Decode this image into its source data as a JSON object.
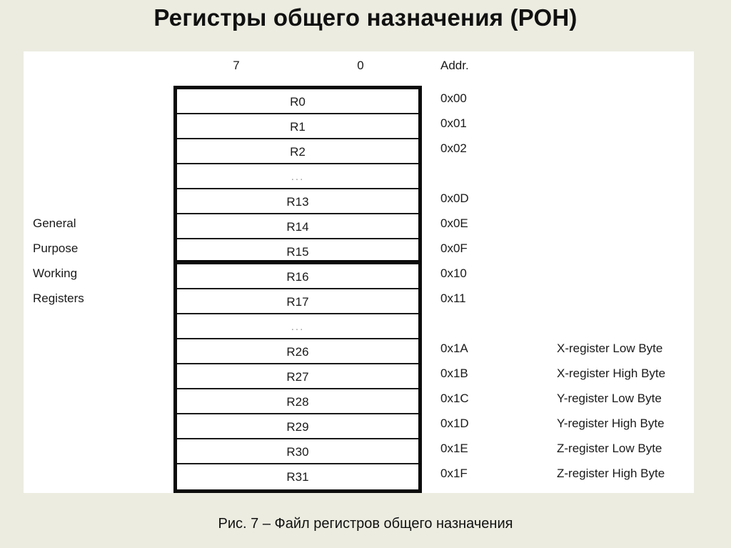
{
  "slide": {
    "title": "Регистры общего назначения (РОН)",
    "caption": "Рис. 7 – Файл регистров общего назначения"
  },
  "table_headers": {
    "msb": "7",
    "lsb": "0",
    "addr": "Addr."
  },
  "group_label": {
    "lines": [
      "General",
      "Purpose",
      "Working",
      "Registers"
    ]
  },
  "colors": {
    "slide_background": "#ECECE1",
    "panel_background": "#FFFFFF",
    "table_border": "#0B0B0B",
    "row_divider": "#1A1A1A",
    "text": "#1A1A1A",
    "ellipsis_text": "#9A9A9A"
  },
  "register_file": {
    "rows": [
      {
        "name": "R0",
        "addr": "0x00",
        "pointer": "",
        "bank_end": false,
        "ellipsis": false
      },
      {
        "name": "R1",
        "addr": "0x01",
        "pointer": "",
        "bank_end": false,
        "ellipsis": false
      },
      {
        "name": "R2",
        "addr": "0x02",
        "pointer": "",
        "bank_end": false,
        "ellipsis": false
      },
      {
        "name": "...",
        "addr": "",
        "pointer": "",
        "bank_end": false,
        "ellipsis": true
      },
      {
        "name": "R13",
        "addr": "0x0D",
        "pointer": "",
        "bank_end": false,
        "ellipsis": false
      },
      {
        "name": "R14",
        "addr": "0x0E",
        "pointer": "",
        "bank_end": false,
        "ellipsis": false
      },
      {
        "name": "R15",
        "addr": "0x0F",
        "pointer": "",
        "bank_end": true,
        "ellipsis": false
      },
      {
        "name": "R16",
        "addr": "0x10",
        "pointer": "",
        "bank_end": false,
        "ellipsis": false
      },
      {
        "name": "R17",
        "addr": "0x11",
        "pointer": "",
        "bank_end": false,
        "ellipsis": false
      },
      {
        "name": "...",
        "addr": "",
        "pointer": "",
        "bank_end": false,
        "ellipsis": true
      },
      {
        "name": "R26",
        "addr": "0x1A",
        "pointer": "X-register Low Byte",
        "bank_end": false,
        "ellipsis": false
      },
      {
        "name": "R27",
        "addr": "0x1B",
        "pointer": "X-register High Byte",
        "bank_end": false,
        "ellipsis": false
      },
      {
        "name": "R28",
        "addr": "0x1C",
        "pointer": "Y-register Low Byte",
        "bank_end": false,
        "ellipsis": false
      },
      {
        "name": "R29",
        "addr": "0x1D",
        "pointer": "Y-register High Byte",
        "bank_end": false,
        "ellipsis": false
      },
      {
        "name": "R30",
        "addr": "0x1E",
        "pointer": "Z-register Low Byte",
        "bank_end": false,
        "ellipsis": false
      },
      {
        "name": "R31",
        "addr": "0x1F",
        "pointer": "Z-register High Byte",
        "bank_end": false,
        "ellipsis": false
      }
    ]
  }
}
